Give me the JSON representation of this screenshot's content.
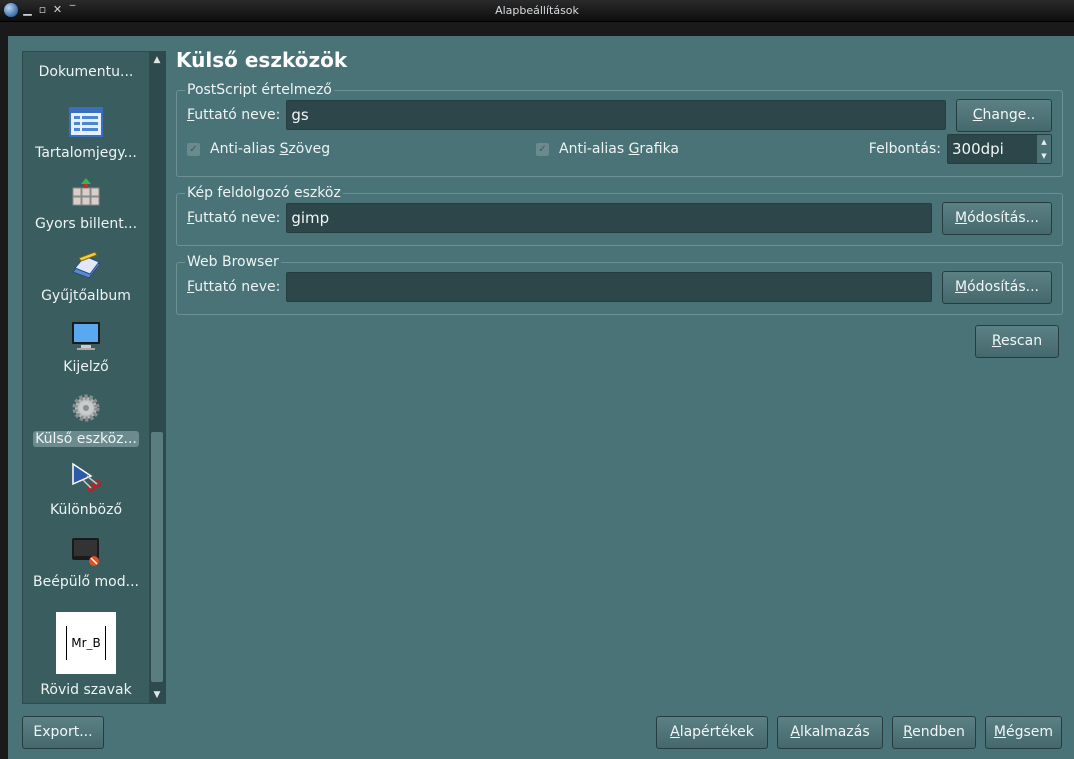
{
  "window": {
    "title": "Alapbeállítások"
  },
  "sidebar": {
    "items": [
      {
        "label": "Dokumentu...",
        "icon": "document-icon"
      },
      {
        "label": "Tartalomjegy...",
        "icon": "table-of-contents-icon"
      },
      {
        "label": "Gyors billent...",
        "icon": "keyboard-shortcut-icon"
      },
      {
        "label": "Gyűjtőalbum",
        "icon": "scrapbook-icon"
      },
      {
        "label": "Kijelző",
        "icon": "monitor-icon"
      },
      {
        "label": "Külső eszköz...",
        "icon": "gear-icon",
        "selected": true
      },
      {
        "label": "Különböző",
        "icon": "misc-tools-icon"
      },
      {
        "label": "Beépülő mod...",
        "icon": "plugin-icon"
      },
      {
        "label": "Rövid szavak",
        "icon": "short-words-icon",
        "logo_text": "Mr_B"
      },
      {
        "label": "",
        "icon": "python-icon"
      }
    ]
  },
  "main": {
    "title": "Külső eszközök",
    "postscript": {
      "legend": "PostScript értelmező",
      "exec_label_first": "F",
      "exec_label_rest": "uttató neve:",
      "exec_value": "gs",
      "change_first": "C",
      "change_rest": "hange..",
      "aa_text_pre": "Anti-alias ",
      "aa_text_u": "S",
      "aa_text_post": "zöveg",
      "aa_graphics_pre": "Anti-alias ",
      "aa_graphics_u": "G",
      "aa_graphics_post": "rafika",
      "resolution_label": "Felbontás:",
      "resolution_value": "300dpi"
    },
    "image_tool": {
      "legend": "Kép feldolgozó eszköz",
      "exec_label_first": "F",
      "exec_label_rest": "uttató neve:",
      "exec_value": "gimp",
      "modify_first": "M",
      "modify_rest": "ódosítás..."
    },
    "web_browser": {
      "legend": "Web Browser",
      "exec_label_first": "F",
      "exec_label_rest": "uttató neve:",
      "exec_value": "",
      "modify_first": "M",
      "modify_rest": "ódosítás..."
    },
    "rescan_first": "R",
    "rescan_rest": "escan"
  },
  "footer": {
    "export": "Export...",
    "defaults_first": "A",
    "defaults_rest": "lapértékek",
    "apply_first": "A",
    "apply_rest": "lkalmazás",
    "ok_first": "R",
    "ok_rest": "endben",
    "cancel_first": "M",
    "cancel_rest": "égsem"
  }
}
